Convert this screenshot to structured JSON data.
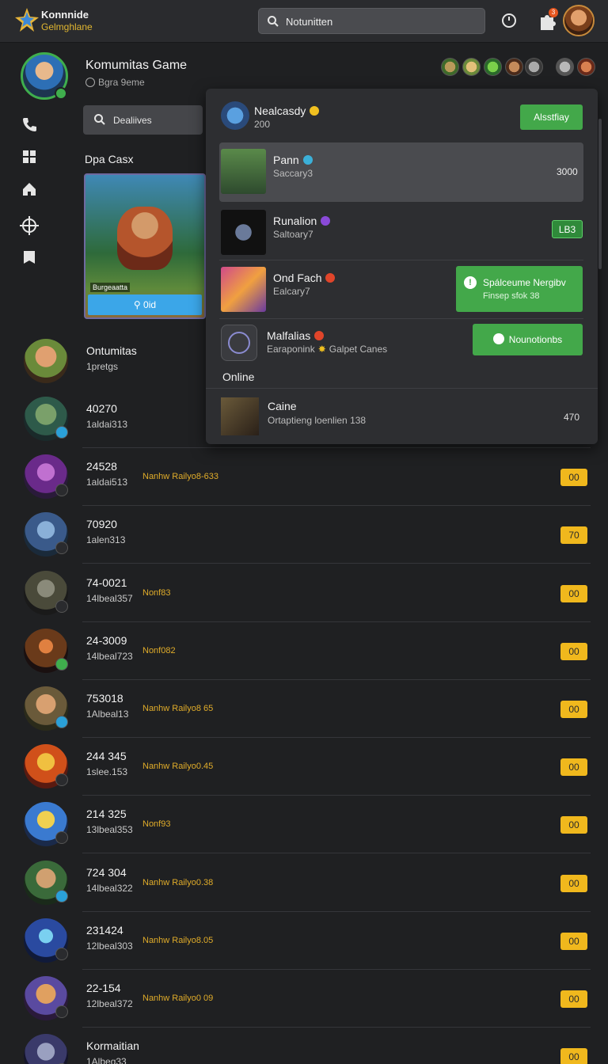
{
  "header": {
    "logo_line1": "Konnnide",
    "logo_line2": "Gelmghlane",
    "search_text": "Notunitten",
    "notif_count": "3"
  },
  "group": {
    "title": "Komumitas Game",
    "subtitle": "Bgra 9eme"
  },
  "sidebar_search": "Dealiives",
  "featured": {
    "label": "Dpa Casx",
    "caption": "Burgeaatta",
    "button": "0id"
  },
  "panel": {
    "items": [
      {
        "name": "Nealcasdy",
        "sub": "200",
        "button": "Alsstfiay",
        "badge_color": "#f0c020"
      },
      {
        "name": "Pann",
        "sub": "Saccary3",
        "value": "3000",
        "badge_color": "#3bb0d8"
      },
      {
        "name": "Runalion",
        "sub": "Saltoary7",
        "button": "LB3",
        "badge_color": "#8a4ad8"
      },
      {
        "name": "Ond Fach",
        "sub": "Ealcary7",
        "button_line1": "Spálceume Nergibv",
        "button_line2": "Finsep sfok 38",
        "badge_color": "#e0452a"
      },
      {
        "name": "Malfalias",
        "sub": "Earaponink",
        "sub2": "Galpet Canes",
        "button": "Nounotionbs",
        "badge_color": "#e0452a"
      }
    ],
    "section_label": "Online",
    "online": {
      "name": "Caine",
      "sub": "Ortaptieng loenlien 138",
      "value": "470"
    }
  },
  "list": {
    "header_name": "Ontumitas",
    "header_sub": "1pretgs",
    "rows": [
      {
        "num": "40270",
        "sub": "1aldai313",
        "mid": "",
        "pill": ""
      },
      {
        "num": "24528",
        "sub": "1aldai513",
        "mid": "Nanhw Railyo8-633",
        "pill": "00"
      },
      {
        "num": "70920",
        "sub": "1alen313",
        "mid": "",
        "pill": "70"
      },
      {
        "num": "74-0021",
        "sub": "14lbeal357",
        "mid": "Nonf83",
        "pill": "00"
      },
      {
        "num": "24-3009",
        "sub": "14lbeal723",
        "mid": "Nonf082",
        "pill": "00"
      },
      {
        "num": "753018",
        "sub": "1Albeal13",
        "mid": "Nanhw Railyo8 65",
        "pill": "00"
      },
      {
        "num": "244 345",
        "sub": "1slee.153",
        "mid": "Nanhw Railyo0.45",
        "pill": "00"
      },
      {
        "num": "214 325",
        "sub": "13lbeal353",
        "mid": "Nonf93",
        "pill": "00"
      },
      {
        "num": "724 304",
        "sub": "14lbeal322",
        "mid": "Nanhw Railyo0.38",
        "pill": "00"
      },
      {
        "num": "231424",
        "sub": "12lbeal303",
        "mid": "Nanhw Railyo8.05",
        "pill": "00"
      },
      {
        "num": "22-154",
        "sub": "12lbeal372",
        "mid": "Nanhw Railyo0 09",
        "pill": "00"
      },
      {
        "num": "Kormaitian",
        "sub": "1Albeg33",
        "mid": "",
        "pill": "00"
      }
    ]
  }
}
